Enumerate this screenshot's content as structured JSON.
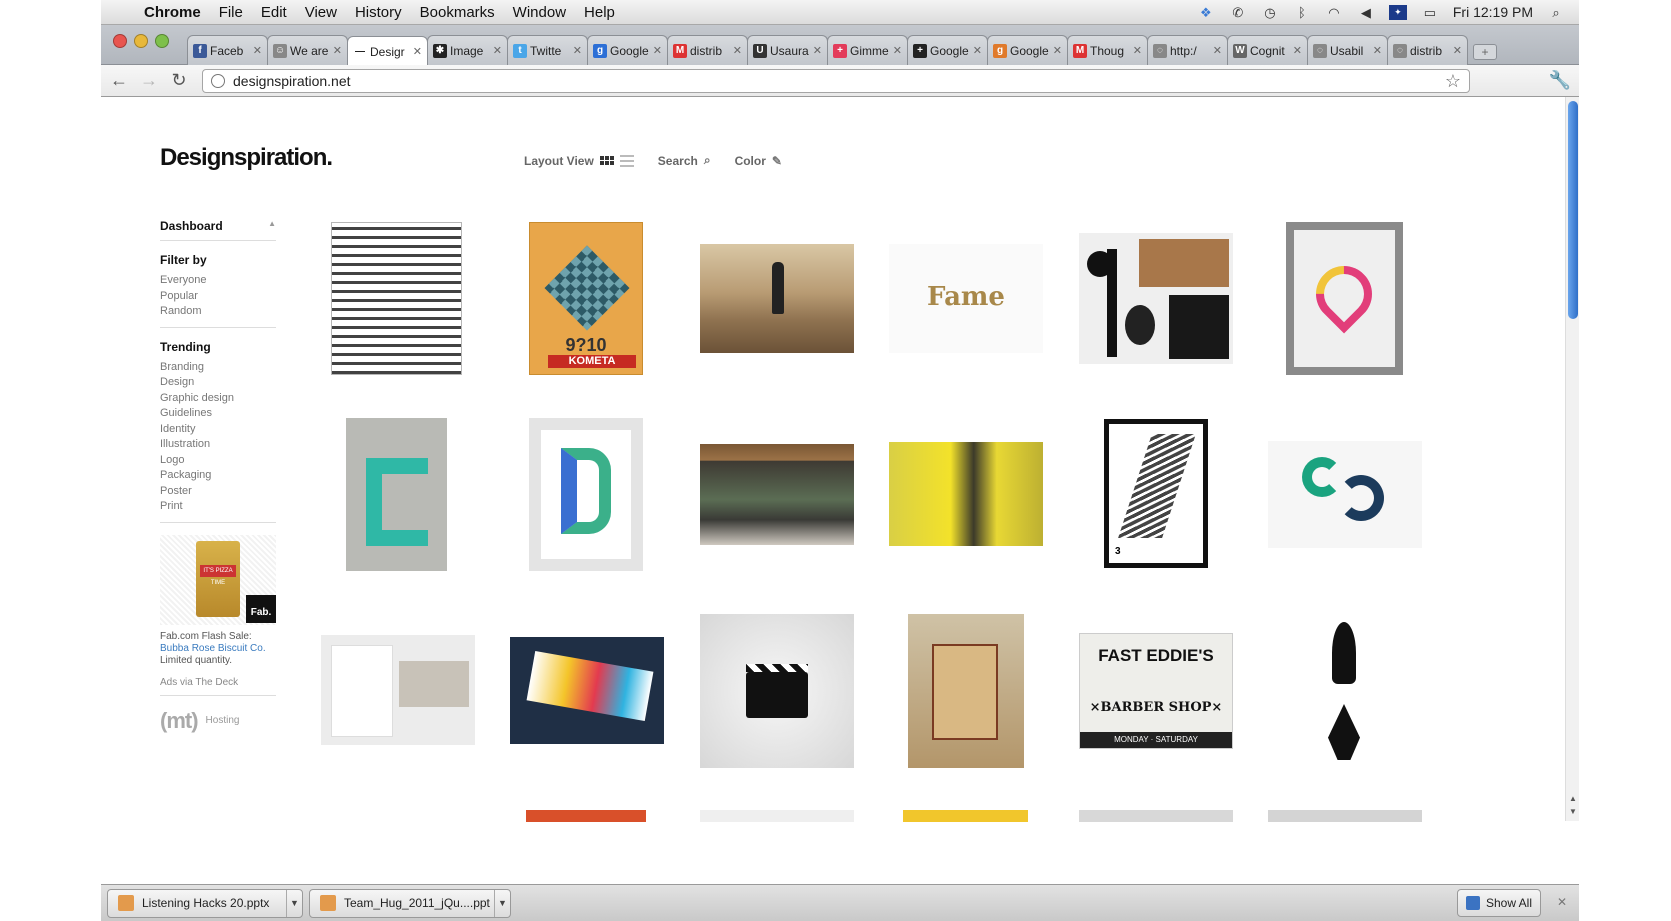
{
  "menubar": {
    "app": "Chrome",
    "items": [
      "File",
      "Edit",
      "View",
      "History",
      "Bookmarks",
      "Window",
      "Help"
    ],
    "clock": "Fri 12:19 PM"
  },
  "tabs": [
    {
      "label": "Faceb",
      "color": "#3b5998",
      "glyph": "f"
    },
    {
      "label": "We are",
      "color": "#888888",
      "glyph": "☺"
    },
    {
      "label": "Desigr",
      "color": "#ffffff",
      "glyph": "—"
    },
    {
      "label": "Image",
      "color": "#222222",
      "glyph": "✱"
    },
    {
      "label": "Twitte",
      "color": "#4aa6e8",
      "glyph": "t"
    },
    {
      "label": "Google",
      "color": "#2c6fd6",
      "glyph": "g"
    },
    {
      "label": "distrib",
      "color": "#d33",
      "glyph": "M"
    },
    {
      "label": "Usaura",
      "color": "#333333",
      "glyph": "U"
    },
    {
      "label": "Gimme",
      "color": "#e33b5a",
      "glyph": "+"
    },
    {
      "label": "Google",
      "color": "#222222",
      "glyph": "+"
    },
    {
      "label": "Google",
      "color": "#e07a2b",
      "glyph": "g"
    },
    {
      "label": "Thoug",
      "color": "#d33",
      "glyph": "M"
    },
    {
      "label": "http:/",
      "color": "#888888",
      "glyph": "◌"
    },
    {
      "label": "Cognit",
      "color": "#666666",
      "glyph": "W"
    },
    {
      "label": "Usabil",
      "color": "#888888",
      "glyph": "◌"
    },
    {
      "label": "distrib",
      "color": "#888888",
      "glyph": "◌"
    }
  ],
  "address": {
    "url": "designspiration.net"
  },
  "site": {
    "logo": "Designspiration.",
    "layout_label": "Layout View",
    "search_label": "Search",
    "color_label": "Color"
  },
  "sidebar": {
    "dashboard": "Dashboard",
    "filter_title": "Filter by",
    "filters": [
      "Everyone",
      "Popular",
      "Random"
    ],
    "trending_title": "Trending",
    "trending": [
      "Branding",
      "Design",
      "Graphic design",
      "Guidelines",
      "Identity",
      "Illustration",
      "Logo",
      "Packaging",
      "Poster",
      "Print"
    ],
    "ad_line1": "Fab.com Flash Sale:",
    "ad_link": "Bubba Rose Biscuit Co.",
    "ad_line3": "Limited quantity.",
    "ad_box_text": "IT'S PIZZA TIME",
    "ad_badge": "Fab.",
    "ads_via": "Ads via The Deck",
    "host_logo": "(mt)",
    "host_label": "Hosting"
  },
  "grid": {
    "fame_text": "Fame",
    "kometa_text": "KOMETA",
    "kometa_num": "9?10",
    "barber_title": "FAST EDDIE'S",
    "barber_sub": "×BARBER SHOP×",
    "barber_days": "MONDAY · SATURDAY"
  },
  "downloads": {
    "items": [
      "Listening Hacks 20.pptx",
      "Team_Hug_2011_jQu....ppt"
    ],
    "show_all": "Show All"
  }
}
